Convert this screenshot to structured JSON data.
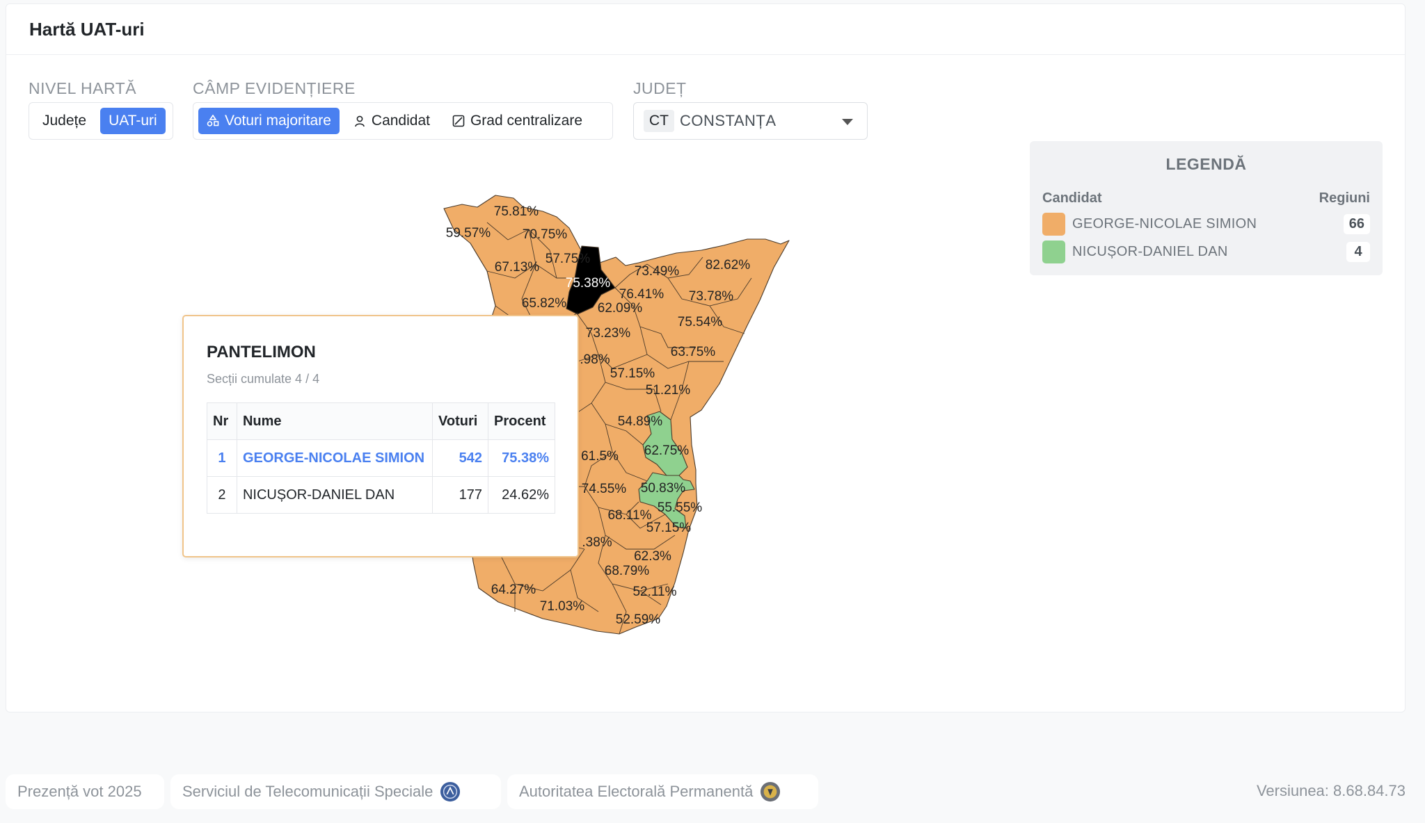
{
  "header": {
    "title": "Hartă UAT-uri"
  },
  "controls": {
    "map_level": {
      "label": "NIVEL HARTĂ",
      "options": [
        "Județe",
        "UAT-uri"
      ],
      "active": "UAT-uri"
    },
    "highlight": {
      "label": "CÂMP EVIDENȚIERE",
      "options": [
        "Voturi majoritare",
        "Candidat",
        "Grad centralizare"
      ],
      "active": "Voturi majoritare"
    },
    "county": {
      "label": "JUDEȚ",
      "code": "CT",
      "value": "CONSTANȚA"
    }
  },
  "legend": {
    "title": "LEGENDĂ",
    "col_candidate": "Candidat",
    "col_regions": "Regiuni",
    "items": [
      {
        "name": "GEORGE-NICOLAE SIMION",
        "color": "#f0ad68",
        "count": "66"
      },
      {
        "name": "NICUȘOR-DANIEL DAN",
        "color": "#8fd18f",
        "count": "4"
      }
    ]
  },
  "colors": {
    "simion": "#f0ad68",
    "dan": "#8fd18f",
    "selected": "#000000",
    "accent": "#4a80f0"
  },
  "map_labels": [
    "75.81%",
    "59.57%",
    "70.75%",
    "67.13%",
    "57.75%",
    "75.38%",
    "73.49%",
    "82.62%",
    "65.82%",
    "76.41%",
    "62.09%",
    "73.78%",
    "75.54%",
    "73.23%",
    "63.75%",
    ".98%",
    "57.15%",
    "51.21%",
    "54.89%",
    "62.75%",
    "61.5%",
    "74.55%",
    "50.83%",
    "55.55%",
    "68.11%",
    "57.15%",
    ".38%",
    "62.3%",
    "68.79%",
    "64.27%",
    "52.11%",
    "71.03%",
    "52.59%"
  ],
  "tooltip": {
    "title": "PANTELIMON",
    "subtitle": "Secții cumulate 4 / 4",
    "headers": [
      "Nr",
      "Nume",
      "Voturi",
      "Procent"
    ],
    "rows": [
      {
        "nr": "1",
        "name": "GEORGE-NICOLAE SIMION",
        "votes": "542",
        "pct": "75.38%"
      },
      {
        "nr": "2",
        "name": "NICUȘOR-DANIEL DAN",
        "votes": "177",
        "pct": "24.62%"
      }
    ]
  },
  "footer": {
    "items": [
      "Prezență vot 2025",
      "Serviciul de Telecomunicații Speciale",
      "Autoritatea Electorală Permanentă"
    ],
    "version": "Versiunea: 8.68.84.73"
  }
}
